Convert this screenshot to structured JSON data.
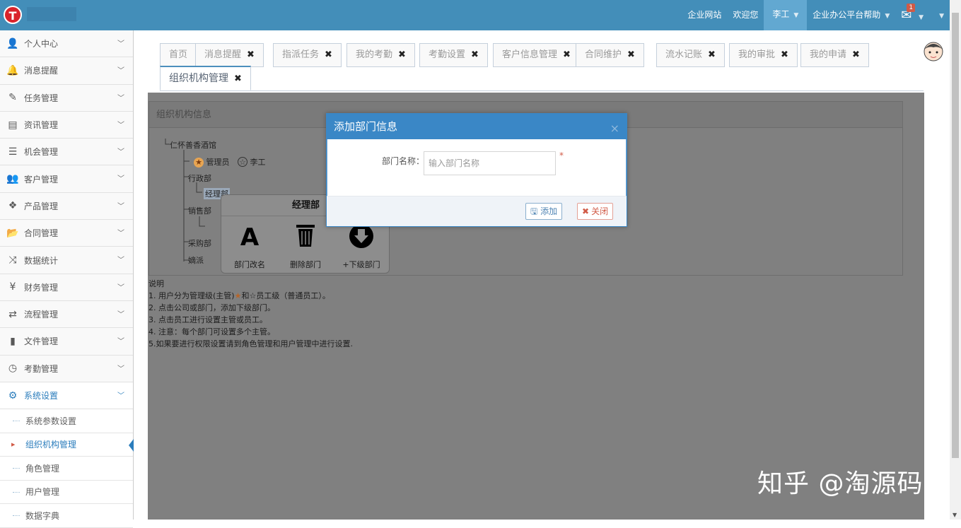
{
  "topbar": {
    "logo_letter": "T",
    "nav": {
      "site": "企业网站",
      "welcome": "欢迎您",
      "user": "李工",
      "help": "企业办公平台帮助",
      "mail_badge": "1"
    }
  },
  "sidebar": {
    "items": [
      {
        "label": "个人中心",
        "icon": "user-icon",
        "glyph": "👤"
      },
      {
        "label": "消息提醒",
        "icon": "bell-icon",
        "glyph": "🔔"
      },
      {
        "label": "任务管理",
        "icon": "edit-icon",
        "glyph": "✎"
      },
      {
        "label": "资讯管理",
        "icon": "document-icon",
        "glyph": "▤"
      },
      {
        "label": "机会管理",
        "icon": "list-icon",
        "glyph": "☰"
      },
      {
        "label": "客户管理",
        "icon": "users-icon",
        "glyph": "👥"
      },
      {
        "label": "产品管理",
        "icon": "dropbox-icon",
        "glyph": "❖"
      },
      {
        "label": "合同管理",
        "icon": "folder-open-icon",
        "glyph": "📂"
      },
      {
        "label": "数据统计",
        "icon": "random-icon",
        "glyph": "⤨"
      },
      {
        "label": "财务管理",
        "icon": "yen-icon",
        "glyph": "¥"
      },
      {
        "label": "流程管理",
        "icon": "retweet-icon",
        "glyph": "⇄"
      },
      {
        "label": "文件管理",
        "icon": "file-icon",
        "glyph": "▮"
      },
      {
        "label": "考勤管理",
        "icon": "clock-icon",
        "glyph": "◷"
      },
      {
        "label": "系统设置",
        "icon": "gear-icon",
        "glyph": "⚙"
      }
    ],
    "submenu": [
      {
        "label": "系统参数设置"
      },
      {
        "label": "组织机构管理"
      },
      {
        "label": "角色管理"
      },
      {
        "label": "用户管理"
      },
      {
        "label": "数据字典"
      }
    ]
  },
  "tabs": [
    {
      "label": "首页"
    },
    {
      "label": "消息提醒"
    },
    {
      "label": "指派任务"
    },
    {
      "label": "我的考勤"
    },
    {
      "label": "考勤设置"
    },
    {
      "label": "客户信息管理"
    },
    {
      "label": "合同维护"
    },
    {
      "label": "流水记账"
    },
    {
      "label": "我的审批"
    },
    {
      "label": "我的申请"
    },
    {
      "label": "组织机构管理"
    }
  ],
  "tab_close_glyph": "✖",
  "panel": {
    "title": "组织机构信息"
  },
  "tree": {
    "root": "仁怀善香酒馆",
    "manager": "管理员",
    "employee": "李工",
    "dept1": "行政部",
    "dept1_child": "经理部",
    "dept2": "销售部",
    "dept3": "采购部",
    "dept4": "嫡派"
  },
  "popup": {
    "title": "经理部",
    "rename": "部门改名",
    "delete": "删除部门",
    "add_child": "+下级部门"
  },
  "notes": {
    "title": "说明",
    "line1a": "1. 用户分为管理级(主管)",
    "line1b": "和",
    "line1c": "员工级（普通员工）。",
    "line2": "2. 点击公司或部门，添加下级部门。",
    "line3": "3. 点击员工进行设置主管或员工。",
    "line4": "4. 注意：每个部门可设置多个主管。",
    "line5": "5.如果要进行权限设置请到角色管理和用户管理中进行设置."
  },
  "modal": {
    "title": "添加部门信息",
    "close_glyph": "×",
    "field_label": "部门名称：",
    "field_placeholder": "输入部门名称",
    "required_mark": "*",
    "add_button": "添加",
    "close_button": "关闭"
  },
  "watermark": "知乎 @淘源码",
  "colors": {
    "topbar": "#438eb9",
    "accent": "#2b7dbc",
    "modal_header": "#3a87c6",
    "overlay": "#808080"
  }
}
